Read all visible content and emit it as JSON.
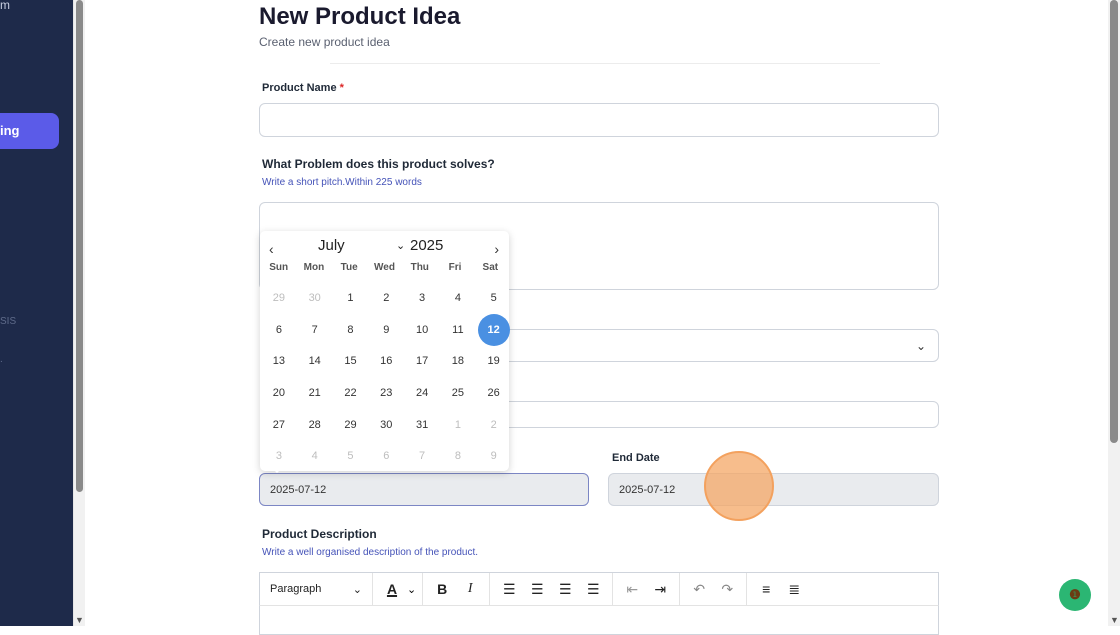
{
  "sidebar": {
    "top_fragment": "m",
    "active_item": "ing",
    "section_label": "SIS",
    "dot_fragment": "."
  },
  "page": {
    "title": "New Product Idea",
    "subtitle": "Create new product idea"
  },
  "form": {
    "product_name": {
      "label": "Product Name",
      "required_mark": "*",
      "value": ""
    },
    "problem": {
      "label": "What Problem does this product solves?",
      "hint": "Write a short pitch.Within 225 words",
      "value": ""
    },
    "start_date": {
      "value": "2025-07-12"
    },
    "end_date": {
      "label": "End Date",
      "value": "2025-07-12"
    },
    "description": {
      "label": "Product Description",
      "hint": "Write a well organised description of the product."
    }
  },
  "calendar": {
    "month": "July",
    "year": "2025",
    "weekdays": [
      "Sun",
      "Mon",
      "Tue",
      "Wed",
      "Thu",
      "Fri",
      "Sat"
    ],
    "days": [
      {
        "d": "29",
        "m": true
      },
      {
        "d": "30",
        "m": true
      },
      {
        "d": "1"
      },
      {
        "d": "2"
      },
      {
        "d": "3"
      },
      {
        "d": "4"
      },
      {
        "d": "5"
      },
      {
        "d": "6"
      },
      {
        "d": "7"
      },
      {
        "d": "8"
      },
      {
        "d": "9"
      },
      {
        "d": "10"
      },
      {
        "d": "11"
      },
      {
        "d": "12",
        "sel": true
      },
      {
        "d": "13"
      },
      {
        "d": "14"
      },
      {
        "d": "15"
      },
      {
        "d": "16"
      },
      {
        "d": "17"
      },
      {
        "d": "18"
      },
      {
        "d": "19"
      },
      {
        "d": "20"
      },
      {
        "d": "21"
      },
      {
        "d": "22"
      },
      {
        "d": "23"
      },
      {
        "d": "24"
      },
      {
        "d": "25"
      },
      {
        "d": "26"
      },
      {
        "d": "27"
      },
      {
        "d": "28"
      },
      {
        "d": "29"
      },
      {
        "d": "30"
      },
      {
        "d": "31"
      },
      {
        "d": "1",
        "m": true
      },
      {
        "d": "2",
        "m": true
      },
      {
        "d": "3",
        "m": true
      },
      {
        "d": "4",
        "m": true
      },
      {
        "d": "5",
        "m": true
      },
      {
        "d": "6",
        "m": true
      },
      {
        "d": "7",
        "m": true
      },
      {
        "d": "8",
        "m": true
      },
      {
        "d": "9",
        "m": true
      }
    ]
  },
  "toolbar": {
    "paragraph": "Paragraph",
    "font_color_glyph": "A",
    "bold_glyph": "B",
    "italic_glyph": "I"
  },
  "colors": {
    "sidebar_bg": "#1e2a4a",
    "accent": "#5b5be8",
    "selected_day": "#4a90e2",
    "help_button": "#2bb673"
  }
}
